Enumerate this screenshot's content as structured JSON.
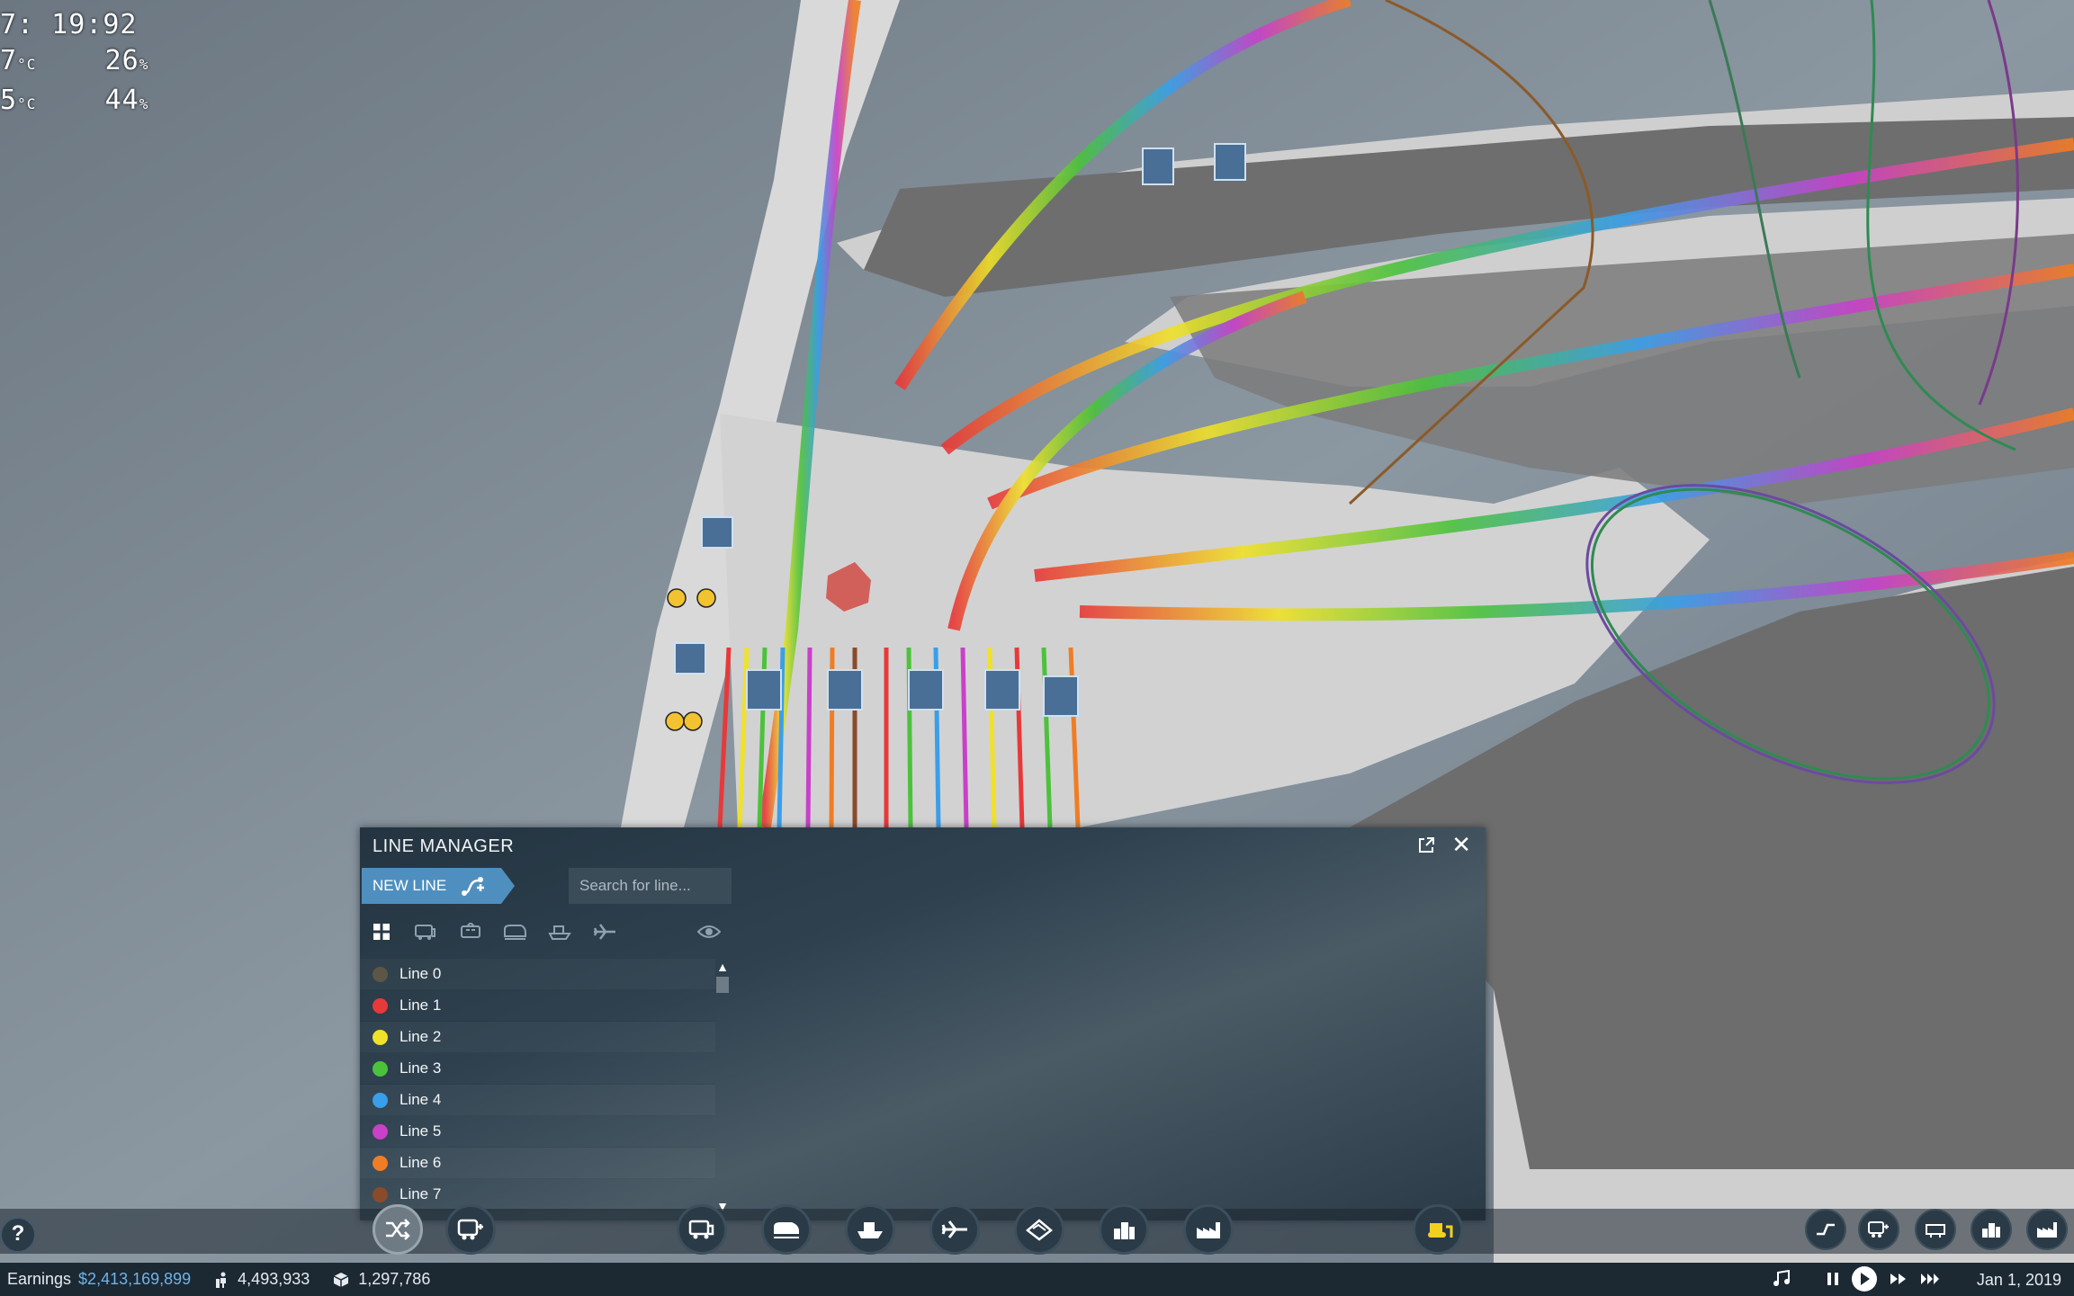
{
  "overlay": {
    "clock": "7: 19:92",
    "stat_row_1": {
      "prefix": "7",
      "unit_a": "°C",
      "value": "26",
      "unit_b": "%"
    },
    "stat_row_2": {
      "prefix": "5",
      "unit_a": "°C",
      "value": "44",
      "unit_b": "%"
    }
  },
  "line_manager": {
    "title": "LINE MANAGER",
    "new_line_label": "NEW LINE",
    "search_placeholder": "Search for line...",
    "filter_icons": [
      "all-grid-icon",
      "road-vehicle-icon",
      "tram-icon",
      "train-icon",
      "ship-icon",
      "airplane-icon"
    ],
    "lines": [
      {
        "label": "Line 0",
        "color": "#5d5646"
      },
      {
        "label": "Line 1",
        "color": "#e8393a"
      },
      {
        "label": "Line 2",
        "color": "#f0e12a"
      },
      {
        "label": "Line 3",
        "color": "#4cc23c"
      },
      {
        "label": "Line 4",
        "color": "#3a9fe8"
      },
      {
        "label": "Line 5",
        "color": "#c940c9"
      },
      {
        "label": "Line 6",
        "color": "#f07d24"
      },
      {
        "label": "Line 7",
        "color": "#8b4a2a"
      }
    ]
  },
  "toolbar": {
    "left_buttons": [
      "lines-shuffle-icon",
      "vehicles-bus-icon"
    ],
    "center_buttons": [
      "road-icon",
      "rail-icon",
      "water-icon",
      "air-icon",
      "terrain-icon",
      "town-icon",
      "industry-icon"
    ],
    "bulldoze": "bulldozer-icon",
    "right_buttons": [
      "layers-icon",
      "vehicle-list-icon",
      "stations-icon",
      "towns-list-icon",
      "industries-list-icon"
    ]
  },
  "status": {
    "earnings_label": "Earnings",
    "earnings_value": "$2,413,169,899",
    "passengers": "4,493,933",
    "cargo": "1,297,786",
    "date": "Jan 1, 2019"
  }
}
